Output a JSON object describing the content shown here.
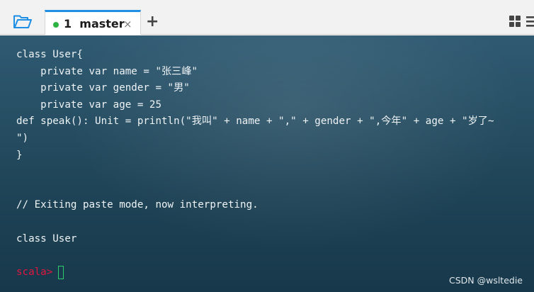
{
  "toolbar": {
    "open_icon": "folder-open-icon",
    "add_label": "+",
    "layout_icon": "grid-layout-icon"
  },
  "tab": {
    "label": "1  master",
    "status_color": "#2db342",
    "close_label": "×",
    "accent": "#1e8fe5"
  },
  "terminal": {
    "lines": [
      "class User{",
      "    private var name = \"张三峰\"",
      "    private var gender = \"男\"",
      "    private var age = 25",
      "def speak(): Unit = println(\"我叫\" + name + \",\" + gender + \",今年\" + age + \"岁了~",
      "\")",
      "}",
      "",
      "",
      "// Exiting paste mode, now interpreting.",
      "",
      "class User",
      ""
    ],
    "prompt": "scala>",
    "prompt_color": "#e0163f",
    "cursor_color": "#2ccc6a"
  },
  "watermark": "CSDN @wsltedie"
}
